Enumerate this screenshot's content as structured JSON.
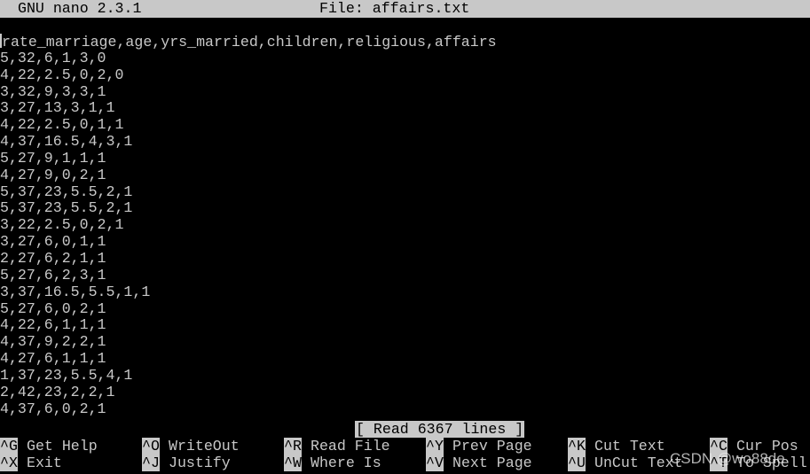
{
  "titlebar": {
    "app": "GNU nano 2.3.1",
    "file": "File: affairs.txt"
  },
  "editor": {
    "lines": [
      "rate_marriage,age,yrs_married,children,religious,affairs",
      "5,32,6,1,3,0",
      "4,22,2.5,0,2,0",
      "3,32,9,3,3,1",
      "3,27,13,3,1,1",
      "4,22,2.5,0,1,1",
      "4,37,16.5,4,3,1",
      "5,27,9,1,1,1",
      "4,27,9,0,2,1",
      "5,37,23,5.5,2,1",
      "5,37,23,5.5,2,1",
      "3,22,2.5,0,2,1",
      "3,27,6,0,1,1",
      "2,27,6,2,1,1",
      "5,27,6,2,3,1",
      "3,37,16.5,5.5,1,1",
      "5,27,6,0,2,1",
      "4,22,6,1,1,1",
      "4,37,9,2,2,1",
      "4,27,6,1,1,1",
      "1,37,23,5.5,4,1",
      "2,42,23,2,2,1",
      "4,37,6,0,2,1"
    ]
  },
  "status": "[ Read 6367 lines ]",
  "shortcuts": [
    {
      "key": "^G",
      "label": "Get Help"
    },
    {
      "key": "^O",
      "label": "WriteOut"
    },
    {
      "key": "^R",
      "label": "Read File"
    },
    {
      "key": "^Y",
      "label": "Prev Page"
    },
    {
      "key": "^K",
      "label": "Cut Text"
    },
    {
      "key": "^C",
      "label": "Cur Pos"
    },
    {
      "key": "^X",
      "label": "Exit"
    },
    {
      "key": "^J",
      "label": "Justify"
    },
    {
      "key": "^W",
      "label": "Where Is"
    },
    {
      "key": "^V",
      "label": "Next Page"
    },
    {
      "key": "^U",
      "label": "UnCut Text"
    },
    {
      "key": "^T",
      "label": "To Spell"
    }
  ],
  "watermark": "CSDN @wo88de",
  "colors": {
    "fg": "#c8c8c8",
    "bg": "#000000"
  }
}
